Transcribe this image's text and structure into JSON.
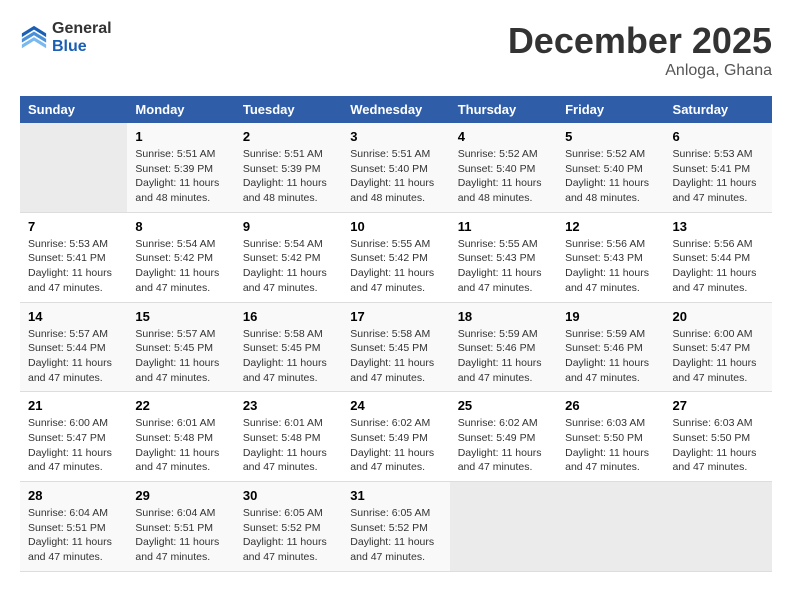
{
  "logo": {
    "general": "General",
    "blue": "Blue"
  },
  "title": "December 2025",
  "location": "Anloga, Ghana",
  "days_of_week": [
    "Sunday",
    "Monday",
    "Tuesday",
    "Wednesday",
    "Thursday",
    "Friday",
    "Saturday"
  ],
  "weeks": [
    [
      {
        "day": "",
        "sunrise": "",
        "sunset": "",
        "daylight": ""
      },
      {
        "day": "1",
        "sunrise": "Sunrise: 5:51 AM",
        "sunset": "Sunset: 5:39 PM",
        "daylight": "Daylight: 11 hours and 48 minutes."
      },
      {
        "day": "2",
        "sunrise": "Sunrise: 5:51 AM",
        "sunset": "Sunset: 5:39 PM",
        "daylight": "Daylight: 11 hours and 48 minutes."
      },
      {
        "day": "3",
        "sunrise": "Sunrise: 5:51 AM",
        "sunset": "Sunset: 5:40 PM",
        "daylight": "Daylight: 11 hours and 48 minutes."
      },
      {
        "day": "4",
        "sunrise": "Sunrise: 5:52 AM",
        "sunset": "Sunset: 5:40 PM",
        "daylight": "Daylight: 11 hours and 48 minutes."
      },
      {
        "day": "5",
        "sunrise": "Sunrise: 5:52 AM",
        "sunset": "Sunset: 5:40 PM",
        "daylight": "Daylight: 11 hours and 48 minutes."
      },
      {
        "day": "6",
        "sunrise": "Sunrise: 5:53 AM",
        "sunset": "Sunset: 5:41 PM",
        "daylight": "Daylight: 11 hours and 47 minutes."
      }
    ],
    [
      {
        "day": "7",
        "sunrise": "Sunrise: 5:53 AM",
        "sunset": "Sunset: 5:41 PM",
        "daylight": "Daylight: 11 hours and 47 minutes."
      },
      {
        "day": "8",
        "sunrise": "Sunrise: 5:54 AM",
        "sunset": "Sunset: 5:42 PM",
        "daylight": "Daylight: 11 hours and 47 minutes."
      },
      {
        "day": "9",
        "sunrise": "Sunrise: 5:54 AM",
        "sunset": "Sunset: 5:42 PM",
        "daylight": "Daylight: 11 hours and 47 minutes."
      },
      {
        "day": "10",
        "sunrise": "Sunrise: 5:55 AM",
        "sunset": "Sunset: 5:42 PM",
        "daylight": "Daylight: 11 hours and 47 minutes."
      },
      {
        "day": "11",
        "sunrise": "Sunrise: 5:55 AM",
        "sunset": "Sunset: 5:43 PM",
        "daylight": "Daylight: 11 hours and 47 minutes."
      },
      {
        "day": "12",
        "sunrise": "Sunrise: 5:56 AM",
        "sunset": "Sunset: 5:43 PM",
        "daylight": "Daylight: 11 hours and 47 minutes."
      },
      {
        "day": "13",
        "sunrise": "Sunrise: 5:56 AM",
        "sunset": "Sunset: 5:44 PM",
        "daylight": "Daylight: 11 hours and 47 minutes."
      }
    ],
    [
      {
        "day": "14",
        "sunrise": "Sunrise: 5:57 AM",
        "sunset": "Sunset: 5:44 PM",
        "daylight": "Daylight: 11 hours and 47 minutes."
      },
      {
        "day": "15",
        "sunrise": "Sunrise: 5:57 AM",
        "sunset": "Sunset: 5:45 PM",
        "daylight": "Daylight: 11 hours and 47 minutes."
      },
      {
        "day": "16",
        "sunrise": "Sunrise: 5:58 AM",
        "sunset": "Sunset: 5:45 PM",
        "daylight": "Daylight: 11 hours and 47 minutes."
      },
      {
        "day": "17",
        "sunrise": "Sunrise: 5:58 AM",
        "sunset": "Sunset: 5:45 PM",
        "daylight": "Daylight: 11 hours and 47 minutes."
      },
      {
        "day": "18",
        "sunrise": "Sunrise: 5:59 AM",
        "sunset": "Sunset: 5:46 PM",
        "daylight": "Daylight: 11 hours and 47 minutes."
      },
      {
        "day": "19",
        "sunrise": "Sunrise: 5:59 AM",
        "sunset": "Sunset: 5:46 PM",
        "daylight": "Daylight: 11 hours and 47 minutes."
      },
      {
        "day": "20",
        "sunrise": "Sunrise: 6:00 AM",
        "sunset": "Sunset: 5:47 PM",
        "daylight": "Daylight: 11 hours and 47 minutes."
      }
    ],
    [
      {
        "day": "21",
        "sunrise": "Sunrise: 6:00 AM",
        "sunset": "Sunset: 5:47 PM",
        "daylight": "Daylight: 11 hours and 47 minutes."
      },
      {
        "day": "22",
        "sunrise": "Sunrise: 6:01 AM",
        "sunset": "Sunset: 5:48 PM",
        "daylight": "Daylight: 11 hours and 47 minutes."
      },
      {
        "day": "23",
        "sunrise": "Sunrise: 6:01 AM",
        "sunset": "Sunset: 5:48 PM",
        "daylight": "Daylight: 11 hours and 47 minutes."
      },
      {
        "day": "24",
        "sunrise": "Sunrise: 6:02 AM",
        "sunset": "Sunset: 5:49 PM",
        "daylight": "Daylight: 11 hours and 47 minutes."
      },
      {
        "day": "25",
        "sunrise": "Sunrise: 6:02 AM",
        "sunset": "Sunset: 5:49 PM",
        "daylight": "Daylight: 11 hours and 47 minutes."
      },
      {
        "day": "26",
        "sunrise": "Sunrise: 6:03 AM",
        "sunset": "Sunset: 5:50 PM",
        "daylight": "Daylight: 11 hours and 47 minutes."
      },
      {
        "day": "27",
        "sunrise": "Sunrise: 6:03 AM",
        "sunset": "Sunset: 5:50 PM",
        "daylight": "Daylight: 11 hours and 47 minutes."
      }
    ],
    [
      {
        "day": "28",
        "sunrise": "Sunrise: 6:04 AM",
        "sunset": "Sunset: 5:51 PM",
        "daylight": "Daylight: 11 hours and 47 minutes."
      },
      {
        "day": "29",
        "sunrise": "Sunrise: 6:04 AM",
        "sunset": "Sunset: 5:51 PM",
        "daylight": "Daylight: 11 hours and 47 minutes."
      },
      {
        "day": "30",
        "sunrise": "Sunrise: 6:05 AM",
        "sunset": "Sunset: 5:52 PM",
        "daylight": "Daylight: 11 hours and 47 minutes."
      },
      {
        "day": "31",
        "sunrise": "Sunrise: 6:05 AM",
        "sunset": "Sunset: 5:52 PM",
        "daylight": "Daylight: 11 hours and 47 minutes."
      },
      {
        "day": "",
        "sunrise": "",
        "sunset": "",
        "daylight": ""
      },
      {
        "day": "",
        "sunrise": "",
        "sunset": "",
        "daylight": ""
      },
      {
        "day": "",
        "sunrise": "",
        "sunset": "",
        "daylight": ""
      }
    ]
  ]
}
